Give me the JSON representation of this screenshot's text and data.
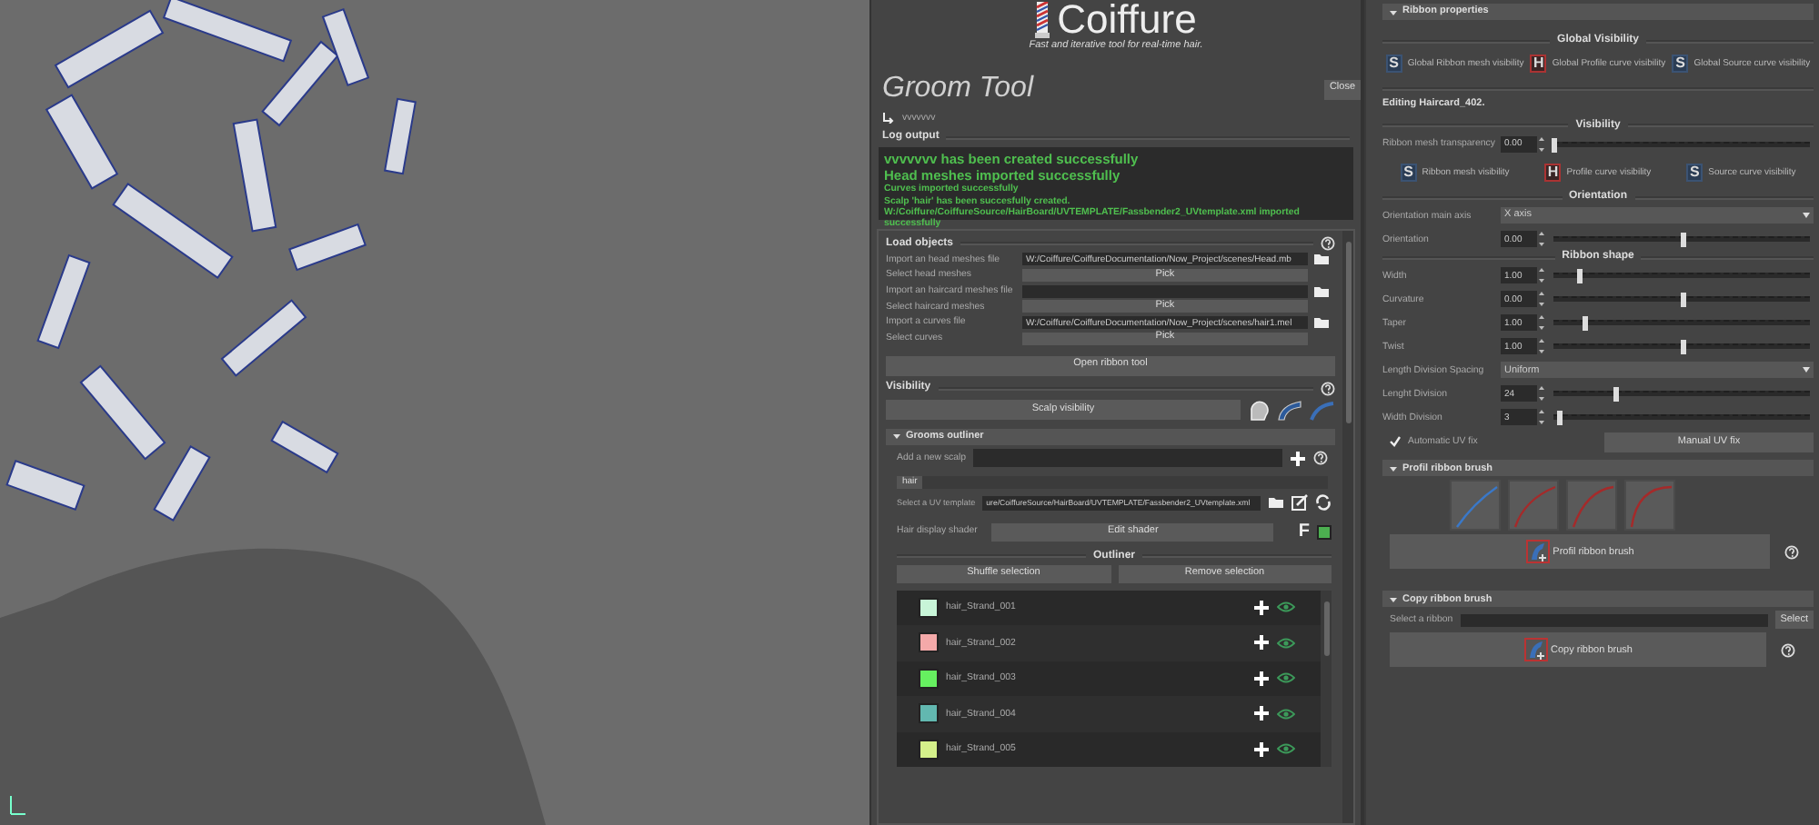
{
  "header": {
    "logo_text": "Coiffure",
    "tagline": "Fast and iterative tool for real-time hair."
  },
  "groom_tool": {
    "title": "Groom Tool",
    "close_button": "Close",
    "scene": "vvvvvvv"
  },
  "log": {
    "title": "Log output",
    "lines": [
      {
        "kind": "headline",
        "text": "vvvvvvv has been created successfully"
      },
      {
        "kind": "headline",
        "text": "Head meshes imported successfully"
      },
      {
        "kind": "detail",
        "text": "Curves imported successfully"
      },
      {
        "kind": "detail",
        "text": "Scalp 'hair' has been succesfully created."
      },
      {
        "kind": "detail",
        "text": "W:/Coiffure/CoiffureSource/HairBoard/UVTEMPLATE/Fassbender2_UVtemplate.xml imported successfully"
      }
    ]
  },
  "load_objects": {
    "title": "Load objects",
    "rows": [
      {
        "kind": "file",
        "label": "Import an head meshes file",
        "value": "W:/Coiffure/CoiffureDocumentation/Now_Project/scenes/Head.mb"
      },
      {
        "kind": "pick",
        "label": "Select head meshes",
        "button": "Pick"
      },
      {
        "kind": "file",
        "label": "Import an haircard meshes file"
      },
      {
        "kind": "pick",
        "label": "Select haircard meshes",
        "button": "Pick"
      },
      {
        "kind": "file",
        "label": "Import a curves file",
        "value": "W:/Coiffure/CoiffureDocumentation/Now_Project/scenes/hair1.mel"
      },
      {
        "kind": "pick",
        "label": "Select curves",
        "button": "Pick"
      }
    ],
    "open_ribbon_button": "Open ribbon tool"
  },
  "visibility": {
    "title": "Visibility",
    "scalp_button": "Scalp visibility"
  },
  "grooms_outliner": {
    "header": "Grooms outliner",
    "add_scalp_label": "Add a new scalp",
    "tabs": [
      {
        "label": "hair",
        "selected": true
      }
    ],
    "uv_label": "Select a UV template",
    "uv_value": "ure/CoiffureSource/HairBoard/UVTEMPLATE/Fassbender2_UVtemplate.xml",
    "shader_label": "Hair display shader",
    "shader_button": "Edit shader",
    "shader_flag": "F",
    "outliner": {
      "title": "Outliner",
      "buttons": [
        "Shuffle selection",
        "Remove selection"
      ],
      "strands": [
        {
          "name": "hair_Strand_001",
          "color": "#c8f5d8"
        },
        {
          "name": "hair_Strand_002",
          "color": "#f4a9a9"
        },
        {
          "name": "hair_Strand_003",
          "color": "#66f060"
        },
        {
          "name": "hair_Strand_004",
          "color": "#62b8b0"
        },
        {
          "name": "hair_Strand_005",
          "color": "#d4f08a"
        }
      ]
    }
  },
  "ribbon_properties": {
    "header": "Ribbon properties",
    "global_visibility": {
      "title": "Global Visibility",
      "toggles": [
        {
          "kind": "shown",
          "letter": "S",
          "label": "Global Ribbon mesh visibility"
        },
        {
          "kind": "hidden",
          "letter": "H",
          "label": "Global Profile curve visibility"
        },
        {
          "kind": "shown",
          "letter": "S",
          "label": "Global Source curve visibility"
        }
      ]
    },
    "editing": "Editing Haircard_402.",
    "visibility": {
      "title": "Visibility",
      "transparency": {
        "label": "Ribbon mesh transparency",
        "value": "0.00",
        "level": 0
      },
      "toggles": [
        {
          "kind": "shown",
          "letter": "S",
          "label": "Ribbon mesh visibility"
        },
        {
          "kind": "hidden",
          "letter": "H",
          "label": "Profile curve visibility"
        },
        {
          "kind": "shown",
          "letter": "S",
          "label": "Source curve visibility"
        }
      ]
    },
    "orientation": {
      "title": "Orientation",
      "rows": [
        {
          "kind": "dropdown",
          "label": "Orientation main axis",
          "value": "X axis"
        },
        {
          "kind": "slider",
          "label": "Orientation",
          "value": "0.00",
          "level": 0.5
        }
      ]
    },
    "ribbon_shape": {
      "title": "Ribbon shape",
      "rows": [
        {
          "kind": "slider",
          "label": "Width",
          "value": "1.00",
          "level": 0.1
        },
        {
          "kind": "slider",
          "label": "Curvature",
          "value": "0.00",
          "level": 0.5
        },
        {
          "kind": "slider",
          "label": "Taper",
          "value": "1.00",
          "level": 0.12
        },
        {
          "kind": "slider",
          "label": "Twist",
          "value": "1.00",
          "level": 0.5
        },
        {
          "kind": "dropdown",
          "label": "Length Division Spacing",
          "value": "Uniform"
        },
        {
          "kind": "slider",
          "label": "Lenght Division",
          "value": "24",
          "level": 0.24
        },
        {
          "kind": "slider",
          "label": "Width Division",
          "value": "3",
          "level": 0.02
        }
      ],
      "auto_uv": {
        "label": "Automatic UV fix",
        "checked": true
      },
      "manual_uv_button": "Manual UV fix"
    }
  },
  "profil_brush": {
    "header": "Profil ribbon brush",
    "presets": [
      {
        "selected": true
      },
      {
        "selected": false
      },
      {
        "selected": false
      },
      {
        "selected": false
      }
    ],
    "button": "Profil ribbon brush"
  },
  "copy_brush": {
    "header": "Copy ribbon brush",
    "select_label": "Select a ribbon",
    "select_button": "Select",
    "button": "Copy ribbon brush"
  }
}
